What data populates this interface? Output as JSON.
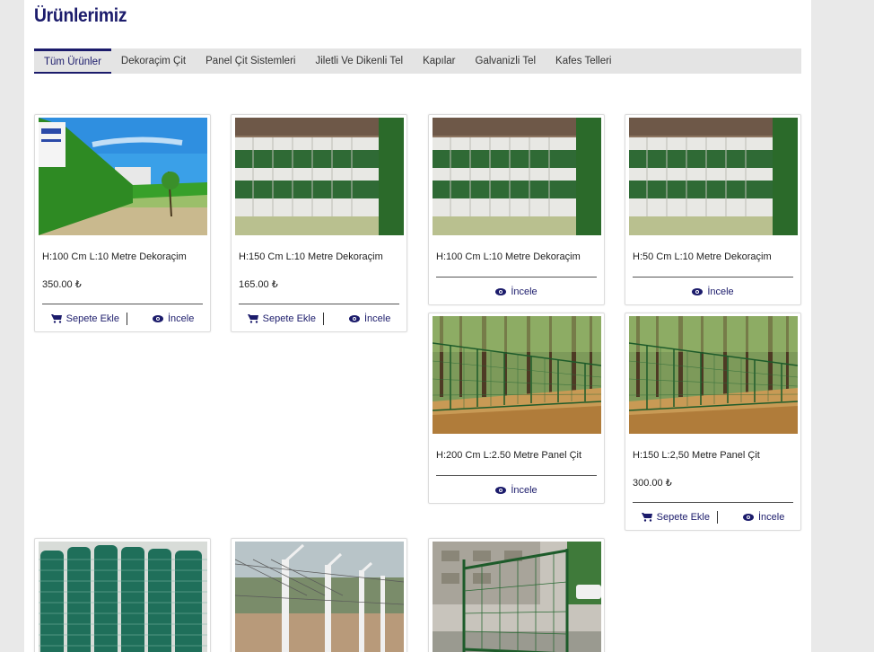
{
  "page_title": "Ürünlerimiz",
  "tabs": [
    {
      "label": "Tüm Ürünler",
      "active": true
    },
    {
      "label": "Dekoraçim Çit",
      "active": false
    },
    {
      "label": "Panel Çit Sistemleri",
      "active": false
    },
    {
      "label": "Jiletli Ve Dikenli Tel",
      "active": false
    },
    {
      "label": "Kapılar",
      "active": false
    },
    {
      "label": "Galvanizli Tel",
      "active": false
    },
    {
      "label": "Kafes Telleri",
      "active": false
    }
  ],
  "actions": {
    "add_to_cart": "Sepete Ekle",
    "inspect": "İncele"
  },
  "products": [
    {
      "name": "H:100 Cm L:10 Metre Dekoraçim",
      "price": "350.00 ₺",
      "image": "green-hedge-wall"
    },
    {
      "name": "H:150 Cm L:10 Metre Dekoraçim",
      "price": "165.00 ₺",
      "image": "rolled-hedge-stack"
    },
    {
      "name": "H:100 Cm L:10 Metre Dekoraçim",
      "price": "",
      "image": "rolled-hedge-stack"
    },
    {
      "name": "H:50 Cm L:10 Metre Dekoraçim",
      "price": "",
      "image": "rolled-hedge-stack"
    },
    {
      "name": "H:200 Cm L:2.50 Metre Panel Çit",
      "price": "",
      "image": "panel-fence-forest"
    },
    {
      "name": "H:150 L:2,50 Metre Panel Çit",
      "price": "300.00 ₺",
      "image": "panel-fence-forest"
    },
    {
      "name": "",
      "price": "",
      "image": "green-wire-rolls"
    },
    {
      "name": "",
      "price": "",
      "image": "barbed-wire-fence"
    },
    {
      "name": "",
      "price": "",
      "image": "green-gate"
    }
  ]
}
